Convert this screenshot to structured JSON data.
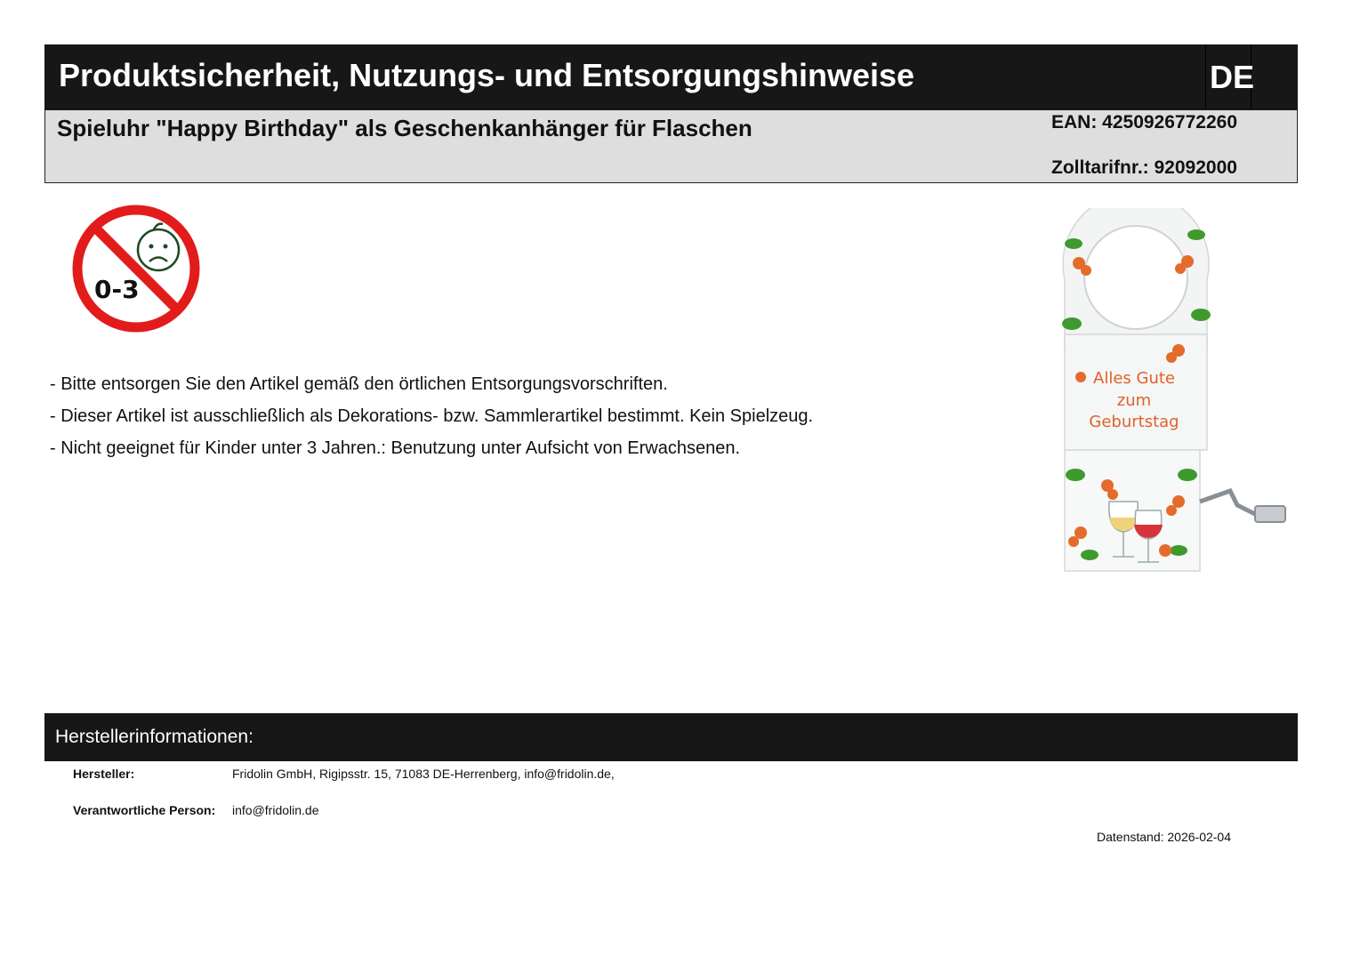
{
  "header": {
    "title": "Produktsicherheit, Nutzungs- und Entsorgungshinweise",
    "language": "DE"
  },
  "product": {
    "name": "Spieluhr \"Happy Birthday\" als Geschenkanhänger für Flaschen",
    "ean": "EAN: 4250926772260",
    "tariff": "Zolltarifnr.: 92092000"
  },
  "warning_icon": {
    "label": "0-3",
    "icon": "not-for-children-under-3-icon",
    "color": "#e21b1b"
  },
  "product_image": {
    "text_line1": "Alles Gute",
    "text_line2": "zum",
    "text_line3": "Geburtstag",
    "text_color": "#e0622a"
  },
  "notes": [
    "- Bitte entsorgen Sie den Artikel gemäß den örtlichen Entsorgungsvorschriften.",
    "- Dieser Artikel ist ausschließlich als Dekorations- bzw. Sammlerartikel bestimmt. Kein Spielzeug.",
    "- Nicht geeignet für Kinder unter 3 Jahren.: Benutzung unter Aufsicht von Erwachsenen."
  ],
  "manufacturer": {
    "heading": "Herstellerinformationen:",
    "manufacturer_label": "Hersteller:",
    "manufacturer_value": "Fridolin GmbH, Rigipsstr. 15, 71083 DE-Herrenberg, info@fridolin.de,",
    "person_label": "Verantwortliche Person:",
    "person_value": "info@fridolin.de",
    "date": "Datenstand: 2026-02-04"
  },
  "colors": {
    "bar_dark": "#171717",
    "bar_light": "#dedede"
  }
}
